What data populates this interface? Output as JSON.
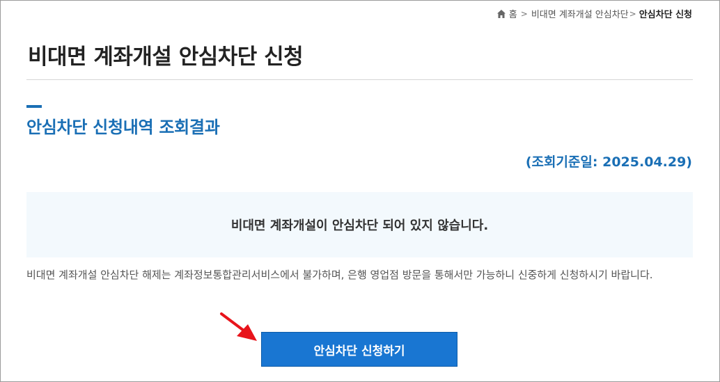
{
  "breadcrumb": {
    "home_label": "홈",
    "level1": "비대면 계좌개설 안심차단",
    "current": "안심차단 신청",
    "icons": {
      "home": "home-icon",
      "separator": "chevron-right-icon"
    }
  },
  "page": {
    "title": "비대면 계좌개설 안심차단 신청"
  },
  "section": {
    "title": "안심차단 신청내역 조회결과",
    "ref_date": "(조회기준일: 2025.04.29)"
  },
  "result": {
    "message": "비대면 계좌개설이 안심차단 되어 있지 않습니다."
  },
  "notice": {
    "text": "비대면 계좌개설 안심차단 해제는 계좌정보통합관리서비스에서 불가하며, 은행 영업점 방문을 통해서만 가능하니 신중하게 신청하시기 바랍니다."
  },
  "actions": {
    "apply_label": "안심차단 신청하기"
  },
  "colors": {
    "accent": "#1a6fb5",
    "button": "#1976d2",
    "result_bg": "#f3f9fd",
    "arrow": "#e8141b"
  }
}
